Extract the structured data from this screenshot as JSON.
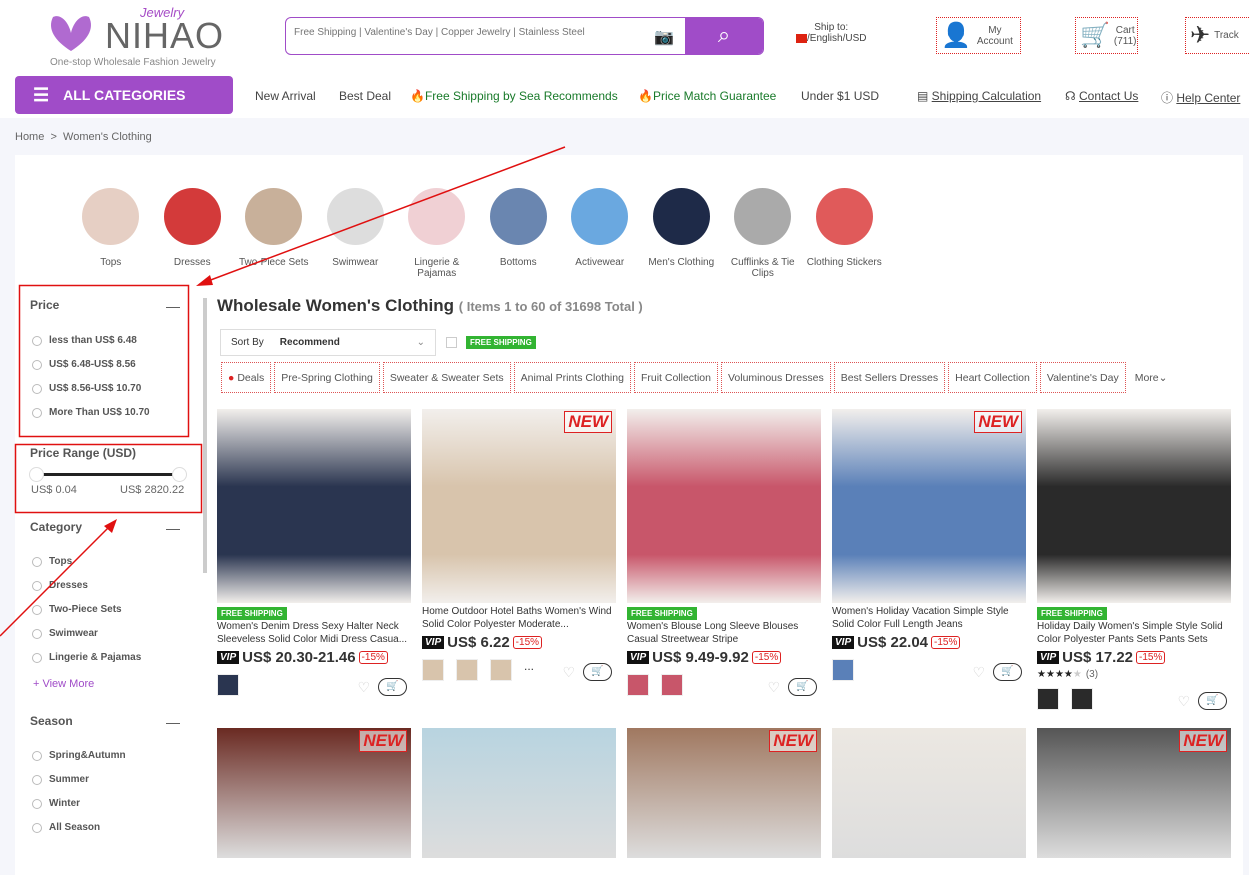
{
  "header": {
    "logo_brand": "NIHAO",
    "logo_script": "Jewelry",
    "logo_tagline": "One-stop Wholesale Fashion Jewelry",
    "search_placeholder": "Free Shipping | Valentine's Day | Copper Jewelry | Stainless Steel",
    "ship_to_label": "Ship to:",
    "ship_to_value": "/English/USD",
    "account": "My Account",
    "cart": "Cart",
    "cart_count": "(711)",
    "track": "Track"
  },
  "nav": {
    "all_categories": "ALL CATEGORIES",
    "links": [
      "New Arrival",
      "Best Deal",
      "Free Shipping by Sea Recommends",
      "Price Match Guarantee",
      "Under $1 USD"
    ],
    "utility": [
      "Shipping Calculation",
      "Contact Us",
      "Help Center"
    ]
  },
  "breadcrumb": [
    "Home",
    ">",
    "Women's Clothing"
  ],
  "categories": [
    "Tops",
    "Dresses",
    "Two-Piece Sets",
    "Swimwear",
    "Lingerie & Pajamas",
    "Bottoms",
    "Activewear",
    "Men's Clothing",
    "Cufflinks & Tie Clips",
    "Clothing Stickers"
  ],
  "sidebar": {
    "price_title": "Price",
    "price_options": [
      "less than US$ 6.48",
      "US$ 6.48-US$ 8.56",
      "US$ 8.56-US$ 10.70",
      "More Than US$ 10.70"
    ],
    "range_title": "Price Range (USD)",
    "range_min": "US$ 0.04",
    "range_max": "US$ 2820.22",
    "category_title": "Category",
    "category_options": [
      "Tops",
      "Dresses",
      "Two-Piece Sets",
      "Swimwear",
      "Lingerie & Pajamas"
    ],
    "view_more": "+ View More",
    "season_title": "Season",
    "season_options": [
      "Spring&Autumn",
      "Summer",
      "Winter",
      "All Season"
    ]
  },
  "main": {
    "title": "Wholesale Women's Clothing",
    "count": "( Items 1 to 60 of 31698 Total )",
    "sort_label": "Sort By",
    "sort_value": "Recommend",
    "free_shipping": "FREE SHIPPING",
    "tags": [
      "Deals",
      "Pre-Spring Clothing",
      "Sweater & Sweater Sets",
      "Animal Prints Clothing",
      "Fruit Collection",
      "Voluminous Dresses",
      "Best Sellers Dresses",
      "Heart Collection",
      "Valentine's Day"
    ],
    "more": "More"
  },
  "products": [
    {
      "name": "Women's Denim Dress Sexy Halter Neck Sleeveless Solid Color Midi Dress Casua...",
      "price": "US$ 20.30-21.46",
      "discount": "-15%",
      "free_shipping": true,
      "new": false,
      "color": "#2a3550",
      "thumbs": 1
    },
    {
      "name": "Home Outdoor Hotel Baths Women's Wind Solid Color Polyester Moderate...",
      "price": "US$ 6.22",
      "discount": "-15%",
      "free_shipping": false,
      "new": true,
      "color": "#d8c4ac",
      "thumbs": 3,
      "more": "..."
    },
    {
      "name": "Women's Blouse Long Sleeve Blouses Casual Streetwear Stripe",
      "price": "US$ 9.49-9.92",
      "discount": "-15%",
      "free_shipping": true,
      "new": false,
      "color": "#c8566a",
      "thumbs": 2
    },
    {
      "name": "Women's Holiday Vacation Simple Style Solid Color Full Length Jeans",
      "price": "US$ 22.04",
      "discount": "-15%",
      "free_shipping": false,
      "new": true,
      "color": "#5a80b8",
      "thumbs": 1
    },
    {
      "name": "Holiday Daily Women's Simple Style Solid Color Polyester Pants Sets Pants Sets",
      "price": "US$ 17.22",
      "discount": "-15%",
      "free_shipping": true,
      "new": false,
      "color": "#2a2a2a",
      "thumbs": 2,
      "rating": 4,
      "reviews": "(3)"
    }
  ],
  "products_row2": [
    {
      "new": true,
      "color": "#6a2a22"
    },
    {
      "new": false,
      "color": "#b8d4e0"
    },
    {
      "new": true,
      "color": "#a07860"
    },
    {
      "new": false,
      "color": "#ece8e2"
    },
    {
      "new": true,
      "color": "#555"
    }
  ],
  "vip": "VIP",
  "new_label": "NEW",
  "annotation_color": "#e01010"
}
